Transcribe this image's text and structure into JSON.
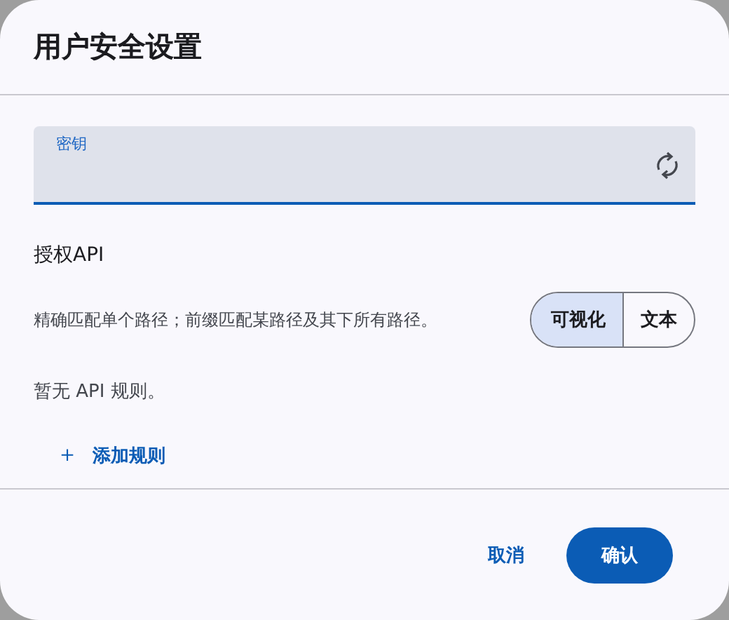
{
  "dialog": {
    "title": "用户安全设置"
  },
  "key_field": {
    "label": "密钥"
  },
  "section": {
    "title": "授权API",
    "description": "精确匹配单个路径；前缀匹配某路径及其下所有路径。"
  },
  "mode_toggle": [
    {
      "label": "可视化",
      "selected": true
    },
    {
      "label": "文本",
      "selected": false
    }
  ],
  "empty_message": "暂无 API 规则。",
  "add_rule": {
    "icon": "＋",
    "label": "添加规则"
  },
  "buttons": [
    {
      "label": "取消",
      "kind": "text"
    },
    {
      "label": "确认",
      "kind": "filled"
    }
  ]
}
